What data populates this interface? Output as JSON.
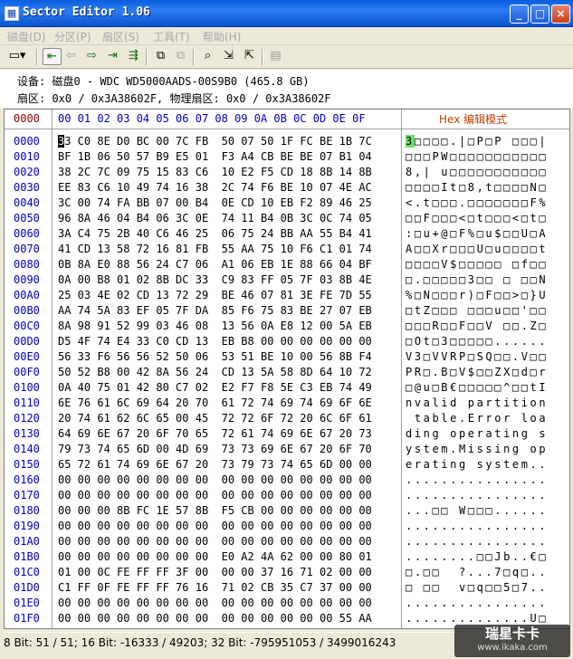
{
  "window": {
    "title": "Sector Editor 1.06",
    "icon": "app-icon",
    "buttons": [
      "_",
      "□",
      "×"
    ]
  },
  "menu": [
    "磁盘(D)",
    "分区(P)",
    "扇区(S)",
    "工具(T)",
    "帮助(H)"
  ],
  "toolbar": {
    "icons": [
      "drive-icon",
      "first-sector-icon",
      "previous-icon",
      "next-icon",
      "last-sector-icon",
      "goto-icon",
      "copy-icon",
      "paste-icon",
      "search-icon",
      "export-icon",
      "import-icon",
      "save-icon"
    ],
    "glyphs": [
      "▭▾",
      "⇤",
      "⇦",
      "⇨",
      "⇥",
      "⇶",
      "⧉",
      "⧉",
      "⌕",
      "⇲",
      "⇱",
      "▤"
    ]
  },
  "info": {
    "device_label": "设备:",
    "device_value": "磁盘0 - WDC WD5000AADS-00S9B0 (465.8 GB)",
    "sector_line": "扇区: 0x0 / 0x3A38602F, 物理扇区: 0x0 / 0x3A38602F"
  },
  "header": {
    "offset": "0000",
    "columns": "00 01 02 03 04 05 06 07  08 09 0A 0B 0C 0D 0E 0F",
    "mode": "Hex 编辑模式"
  },
  "rows": [
    {
      "off": "0000",
      "hex": "33 C0 8E D0 BC 00 7C FB  50 07 50 1F FC BE 1B 7C",
      "asc": "3□□□□.|□P□P □□□|"
    },
    {
      "off": "0010",
      "hex": "BF 1B 06 50 57 B9 E5 01  F3 A4 CB BE BE 07 B1 04",
      "asc": "□□□PW□□□□□□□□□□□"
    },
    {
      "off": "0020",
      "hex": "38 2C 7C 09 75 15 83 C6  10 E2 F5 CD 18 8B 14 8B",
      "asc": "8,| u□□□□□□□□□□□"
    },
    {
      "off": "0030",
      "hex": "EE 83 C6 10 49 74 16 38  2C 74 F6 BE 10 07 4E AC",
      "asc": "□□□□It□8,t□□□□N□"
    },
    {
      "off": "0040",
      "hex": "3C 00 74 FA BB 07 00 B4  0E CD 10 EB F2 89 46 25",
      "asc": "<.t□□□.□□□□□□□F%"
    },
    {
      "off": "0050",
      "hex": "96 8A 46 04 B4 06 3C 0E  74 11 B4 0B 3C 0C 74 05",
      "asc": "□□F□□□<□t□□□<□t□"
    },
    {
      "off": "0060",
      "hex": "3A C4 75 2B 40 C6 46 25  06 75 24 BB AA 55 B4 41",
      "asc": ":□u+@□F%□u$□□U□A"
    },
    {
      "off": "0070",
      "hex": "41 CD 13 58 72 16 81 FB  55 AA 75 10 F6 C1 01 74",
      "asc": "A□□Xr□□□U□u□□□□t"
    },
    {
      "off": "0080",
      "hex": "0B 8A E0 88 56 24 C7 06  A1 06 EB 1E 88 66 04 BF",
      "asc": "□□□□V$□□□□□ □f□□"
    },
    {
      "off": "0090",
      "hex": "0A 00 B8 01 02 8B DC 33  C9 83 FF 05 7F 03 8B 4E",
      "asc": "□.□□□□□3□□ □ □□N"
    },
    {
      "off": "00A0",
      "hex": "25 03 4E 02 CD 13 72 29  BE 46 07 81 3E FE 7D 55",
      "asc": "%□N□□□r)□F□□>□}U"
    },
    {
      "off": "00B0",
      "hex": "AA 74 5A 83 EF 05 7F DA  85 F6 75 83 BE 27 07 EB",
      "asc": "□tZ□□□ □□□u□□'□□"
    },
    {
      "off": "00C0",
      "hex": "8A 98 91 52 99 03 46 08  13 56 0A E8 12 00 5A EB",
      "asc": "□□□R□□F□□V □□.Z□"
    },
    {
      "off": "00D0",
      "hex": "D5 4F 74 E4 33 C0 CD 13  EB B8 00 00 00 00 00 00",
      "asc": "□Ot□3□□□□□......"
    },
    {
      "off": "00E0",
      "hex": "56 33 F6 56 56 52 50 06  53 51 BE 10 00 56 8B F4",
      "asc": "V3□VVRP□SQ□□.V□□"
    },
    {
      "off": "00F0",
      "hex": "50 52 B8 00 42 8A 56 24  CD 13 5A 58 8D 64 10 72",
      "asc": "PR□.B□V$□□ZX□d□r"
    },
    {
      "off": "0100",
      "hex": "0A 40 75 01 42 80 C7 02  E2 F7 F8 5E C3 EB 74 49",
      "asc": "□@u□B€□□□□□^□□tI"
    },
    {
      "off": "0110",
      "hex": "6E 76 61 6C 69 64 20 70  61 72 74 69 74 69 6F 6E",
      "asc": "nvalid partition"
    },
    {
      "off": "0120",
      "hex": "20 74 61 62 6C 65 00 45  72 72 6F 72 20 6C 6F 61",
      "asc": " table.Error loa"
    },
    {
      "off": "0130",
      "hex": "64 69 6E 67 20 6F 70 65  72 61 74 69 6E 67 20 73",
      "asc": "ding operating s"
    },
    {
      "off": "0140",
      "hex": "79 73 74 65 6D 00 4D 69  73 73 69 6E 67 20 6F 70",
      "asc": "ystem.Missing op"
    },
    {
      "off": "0150",
      "hex": "65 72 61 74 69 6E 67 20  73 79 73 74 65 6D 00 00",
      "asc": "erating system.."
    },
    {
      "off": "0160",
      "hex": "00 00 00 00 00 00 00 00  00 00 00 00 00 00 00 00",
      "asc": "................"
    },
    {
      "off": "0170",
      "hex": "00 00 00 00 00 00 00 00  00 00 00 00 00 00 00 00",
      "asc": "................"
    },
    {
      "off": "0180",
      "hex": "00 00 00 8B FC 1E 57 8B  F5 CB 00 00 00 00 00 00",
      "asc": "...□□ W□□□......"
    },
    {
      "off": "0190",
      "hex": "00 00 00 00 00 00 00 00  00 00 00 00 00 00 00 00",
      "asc": "................"
    },
    {
      "off": "01A0",
      "hex": "00 00 00 00 00 00 00 00  00 00 00 00 00 00 00 00",
      "asc": "................"
    },
    {
      "off": "01B0",
      "hex": "00 00 00 00 00 00 00 00  E0 A2 4A 62 00 00 80 01",
      "asc": "........□□Jb..€□"
    },
    {
      "off": "01C0",
      "hex": "01 00 0C FE FF FF 3F 00  00 00 37 16 71 02 00 00",
      "asc": "□.□□  ?...7□q□.."
    },
    {
      "off": "01D0",
      "hex": "C1 FF 0F FE FF FF 76 16  71 02 CB 35 C7 37 00 00",
      "asc": "□ □□  v□q□□5□7.."
    },
    {
      "off": "01E0",
      "hex": "00 00 00 00 00 00 00 00  00 00 00 00 00 00 00 00",
      "asc": "................"
    },
    {
      "off": "01F0",
      "hex": "00 00 00 00 00 00 00 00  00 00 00 00 00 00 55 AA",
      "asc": "..............U□"
    }
  ],
  "status": "8 Bit: 51 / 51;   16 Bit: -16333 / 49203;   32 Bit: -795951053 / 3499016243",
  "watermark": {
    "line1": "瑞星卡卡",
    "line2": "www.ikaka.com"
  }
}
